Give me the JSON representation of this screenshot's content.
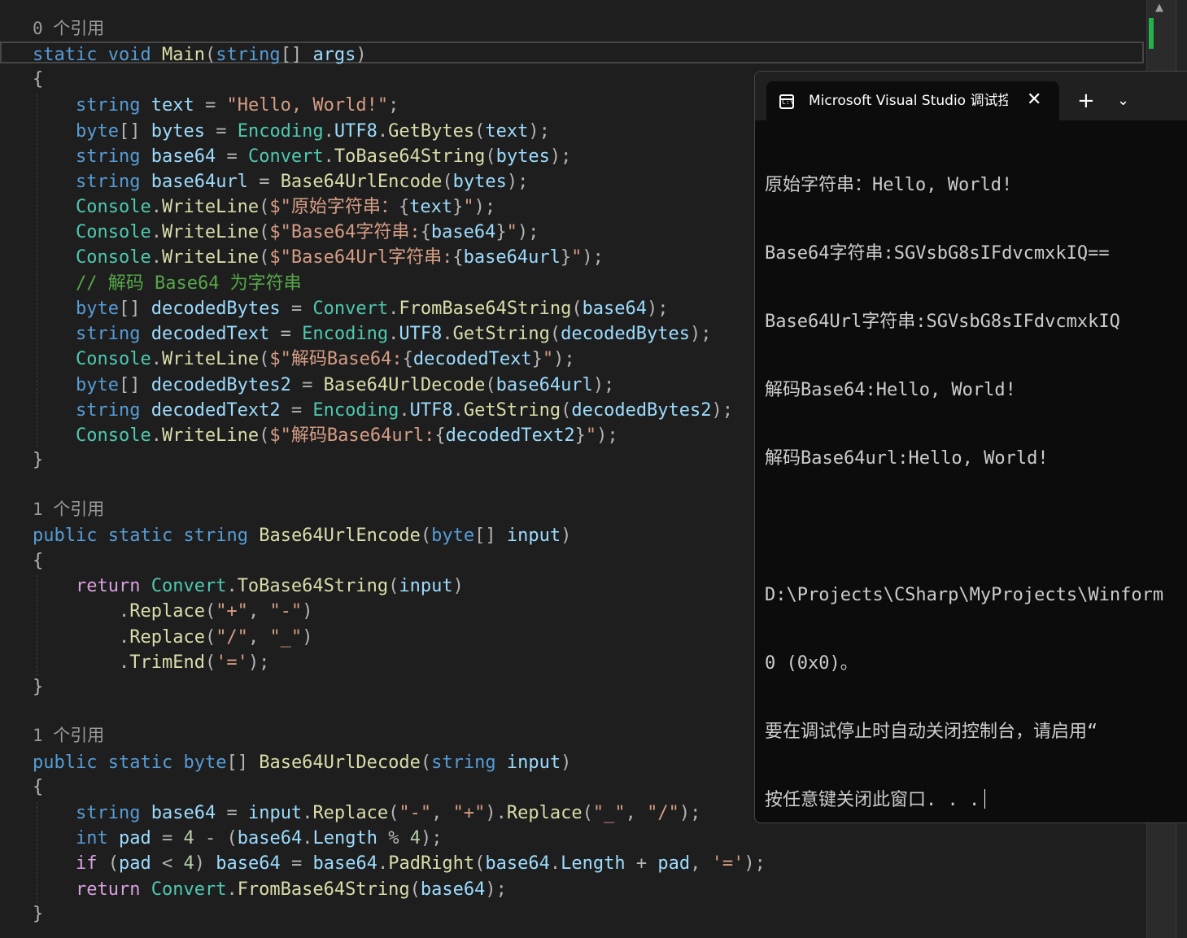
{
  "editor": {
    "codelens": {
      "main": "0 个引用",
      "encode": "1 个引用",
      "decode": "1 个引用"
    },
    "kw": {
      "static": "static",
      "void": "void",
      "string": "string",
      "byte": "byte",
      "public": "public",
      "int": "int"
    },
    "ctl": {
      "return": "return",
      "if": "if"
    },
    "types": {
      "encoding": "Encoding",
      "convert": "Convert",
      "console": "Console"
    },
    "funcs": {
      "main": "Main",
      "getbytes": "GetBytes",
      "tobase64": "ToBase64String",
      "encode": "Base64UrlEncode",
      "decode": "Base64UrlDecode",
      "writeline": "WriteLine",
      "frombase64": "FromBase64String",
      "getstring": "GetString",
      "replace": "Replace",
      "trimend": "TrimEnd",
      "padright": "PadRight"
    },
    "vars": {
      "args": "args",
      "text": "text",
      "bytes": "bytes",
      "base64": "base64",
      "base64url": "base64url",
      "decodedBytes": "decodedBytes",
      "decodedText": "decodedText",
      "decodedBytes2": "decodedBytes2",
      "decodedText2": "decodedText2",
      "input": "input",
      "pad": "pad",
      "utf8": "UTF8",
      "length": "Length"
    },
    "strings": {
      "hello": "\"Hello, World!\"",
      "interp_prefix": "$\"",
      "quote": "\"",
      "lbl_orig": "原始字符串：",
      "lbl_b64": "Base64字符串:",
      "lbl_b64url": "Base64Url字符串:",
      "lbl_dec": "解码Base64:",
      "lbl_decurl": "解码Base64url:",
      "plus": "\"+\"",
      "dash": "\"-\"",
      "slash": "\"/\"",
      "under": "\"_\"",
      "eqchar": "'='"
    },
    "comment": "// 解码 Base64 为字符串",
    "numbers": {
      "four": "4"
    }
  },
  "terminal": {
    "tab_title": "Microsoft Visual Studio 调试控制台",
    "icon_label": "C:\\",
    "lines": [
      "原始字符串：Hello, World!",
      "Base64字符串:SGVsbG8sIFdvcmxkIQ==",
      "Base64Url字符串:SGVsbG8sIFdvcmxkIQ",
      "解码Base64:Hello, World!",
      "解码Base64url:Hello, World!",
      "",
      "D:\\Projects\\CSharp\\MyProjects\\Winform",
      "0 (0x0)。",
      "要在调试停止时自动关闭控制台，请启用“",
      "按任意键关闭此窗口. . ."
    ]
  },
  "colors": {
    "keyword": "#569cd6",
    "type": "#4ec9b0",
    "method": "#dcdcaa",
    "variable": "#9cdcfe",
    "string": "#d69d85",
    "comment": "#57a64a",
    "control": "#d8a0df",
    "scroll_marker": "#24b34a"
  }
}
